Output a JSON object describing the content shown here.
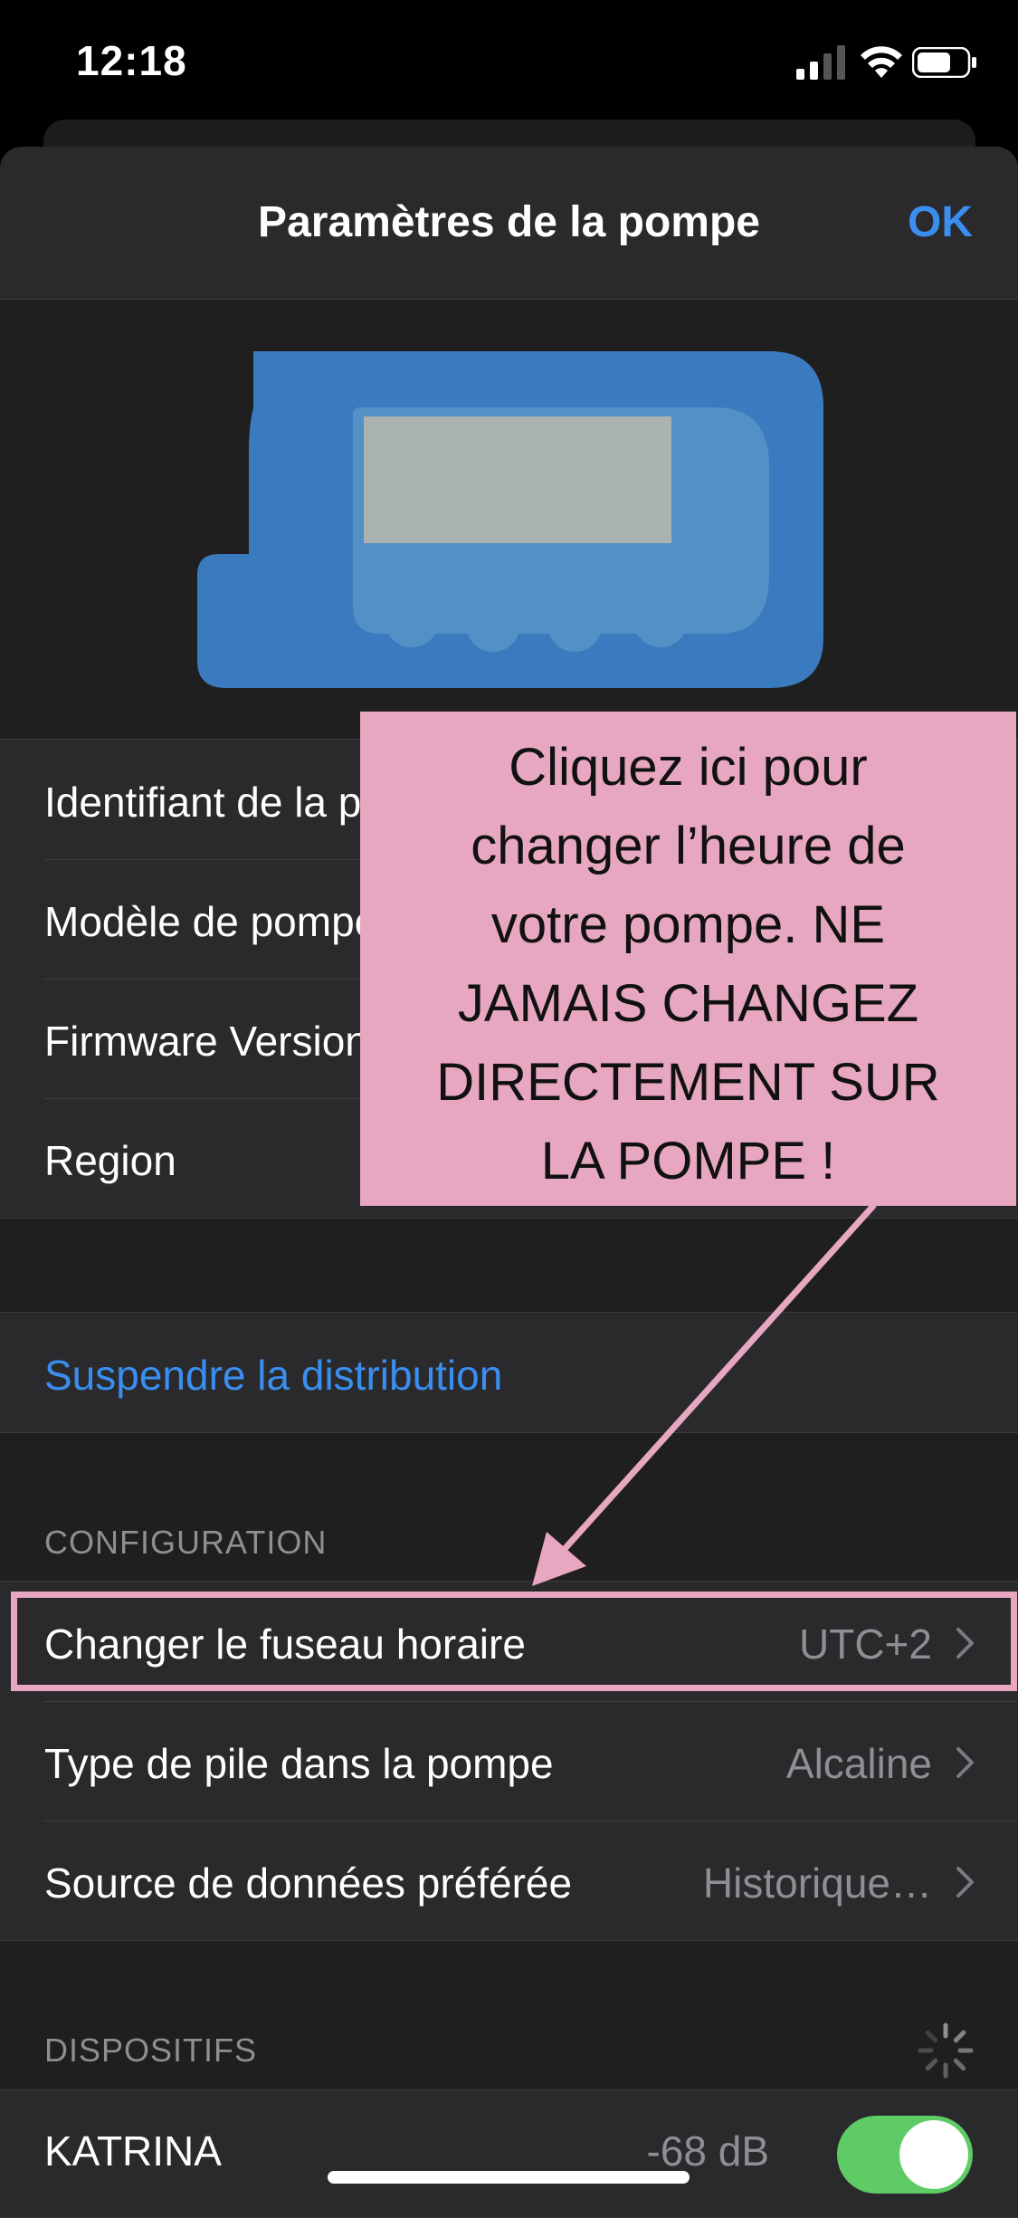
{
  "status_bar": {
    "time": "12:18"
  },
  "nav": {
    "title": "Paramètres de la pompe",
    "done_label": "OK"
  },
  "info_rows": [
    {
      "label": "Identifiant de la pompe"
    },
    {
      "label": "Modèle de pompe"
    },
    {
      "label": "Firmware Version"
    },
    {
      "label": "Region"
    }
  ],
  "suspend_label": "Suspendre la distribution",
  "configuration": {
    "header": "CONFIGURATION",
    "rows": [
      {
        "label": "Changer le fuseau horaire",
        "value": "UTC+2"
      },
      {
        "label": "Type de pile dans la pompe",
        "value": "Alcaline"
      },
      {
        "label": "Source de données préférée",
        "value": "Historique…"
      }
    ]
  },
  "devices": {
    "header": "DISPOSITIFS",
    "rows": [
      {
        "label": "KATRINA",
        "value": "-68 dB",
        "toggle_on": true
      }
    ]
  },
  "annotation": {
    "text": "Cliquez ici pour changer l’heure de votre pompe. NE JAMAIS CHANGEZ DIRECTEMENT SUR LA POMPE !",
    "lines": [
      "Cliquez ici pour",
      "changer l’heure de",
      "votre pompe. NE",
      "JAMAIS CHANGEZ",
      "DIRECTEMENT SUR",
      "LA POMPE !"
    ]
  },
  "colors": {
    "accent": "#3a8ef0",
    "annotation": "#e8a7c0",
    "toggle_on": "#5ecb65",
    "pump_body": "#3a7bbf"
  }
}
